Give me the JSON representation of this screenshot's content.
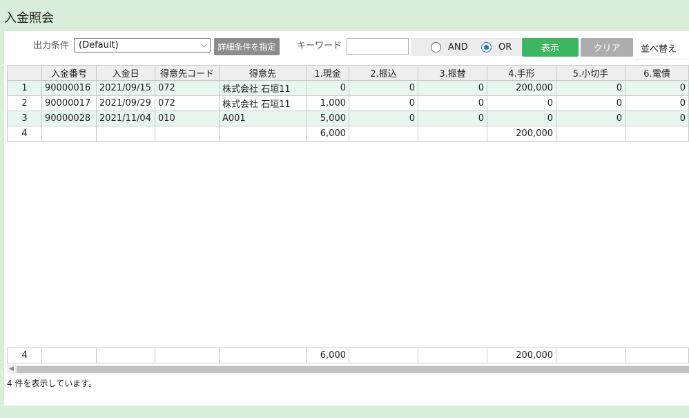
{
  "page_title": "入金照会",
  "toolbar": {
    "output_condition_label": "出力条件",
    "output_condition_value": "(Default)",
    "detail_button": "詳細条件を指定",
    "keyword_label": "キーワード",
    "keyword_value": "",
    "radio_and": "AND",
    "radio_or": "OR",
    "selected_mode": "OR",
    "show_button": "表示",
    "clear_button": "クリア",
    "sort_label": "並べ替え"
  },
  "grid": {
    "columns": [
      "",
      "入金番号",
      "入金日",
      "得意先コード",
      "得意先",
      "1.現金",
      "2.振込",
      "3.振替",
      "4.手形",
      "5.小切手",
      "6.電債"
    ],
    "rows": [
      [
        "1",
        "90000016",
        "2021/09/15",
        "072",
        "株式会社 石垣11",
        "0",
        "0",
        "0",
        "200,000",
        "0",
        "0"
      ],
      [
        "2",
        "90000017",
        "2021/09/29",
        "072",
        "株式会社 石垣11",
        "1,000",
        "0",
        "0",
        "0",
        "0",
        "0"
      ],
      [
        "3",
        "90000028",
        "2021/11/04",
        "010",
        "A001",
        "5,000",
        "0",
        "0",
        "0",
        "0",
        "0"
      ],
      [
        "4",
        "",
        "",
        "",
        "",
        "6,000",
        "",
        "",
        "200,000",
        "",
        ""
      ]
    ],
    "footer": [
      "4",
      "",
      "",
      "",
      "",
      "6,000",
      "",
      "",
      "200,000",
      "",
      ""
    ]
  },
  "status_text": "4 件を表示しています。",
  "colors": {
    "background": "#d8eedb",
    "row_alt": "#e8f7ee",
    "show_button": "#3cb661",
    "clear_button": "#adadad",
    "detail_button": "#8c8c8c",
    "radio_accent": "#1a73e8"
  }
}
